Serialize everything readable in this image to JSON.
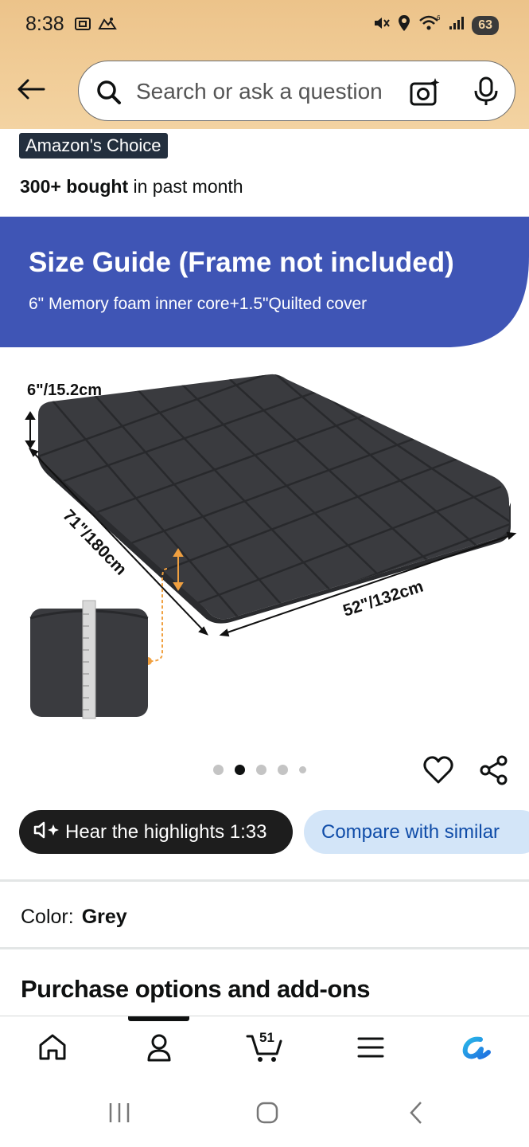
{
  "status_bar": {
    "time": "8:38",
    "battery": "63",
    "icons": [
      "screenshot-icon",
      "driving-icon",
      "mute-icon",
      "location-icon",
      "wifi-icon",
      "signal-icon",
      "battery-icon"
    ]
  },
  "search": {
    "placeholder": "Search or ask a question"
  },
  "badge": {
    "label": "Amazon's Choice"
  },
  "bought": {
    "count": "300+ bought",
    "suffix": " in past month"
  },
  "banner": {
    "title": "Size Guide (Frame not included)",
    "subtitle": "6\" Memory foam inner core+1.5\"Quilted cover",
    "color": "#3f55b5"
  },
  "product_image": {
    "height_label": "6\"/15.2cm",
    "length_label": "71\"/180cm",
    "width_label": "52\"/132cm",
    "mattress_color": "#3a3b3f",
    "accent_color": "#f0a040"
  },
  "carousel": {
    "total": 5,
    "active_index": 1
  },
  "actions": {
    "hear_label": "Hear the highlights 1:33",
    "compare_label": "Compare with similar"
  },
  "color_option": {
    "label": "Color:",
    "value": "Grey"
  },
  "purchase_options": {
    "title": "Purchase options and add-ons"
  },
  "bottom_nav": {
    "items": [
      "home-icon",
      "account-icon",
      "cart-icon",
      "menu-icon",
      "rufus-icon"
    ],
    "cart_count": "51",
    "active_index": 1
  },
  "system_nav": {
    "items": [
      "recents-button",
      "home-button",
      "back-button"
    ]
  },
  "colors": {
    "header_bg": "#f1cd98",
    "badge_bg": "#232f3e",
    "compare_bg": "#d3e5f8",
    "link_blue": "#0f4ca8"
  }
}
